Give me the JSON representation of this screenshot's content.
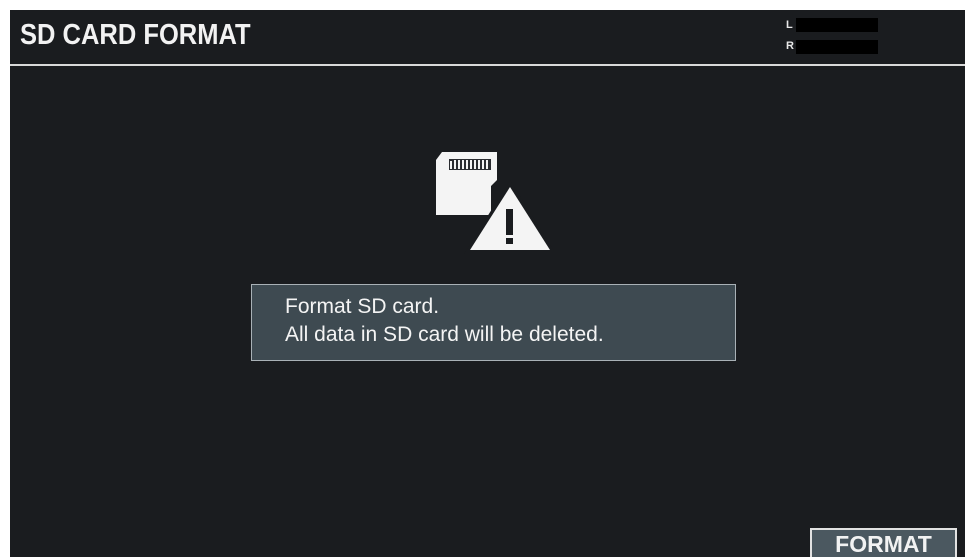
{
  "header": {
    "title": "SD CARD FORMAT",
    "meter": {
      "left_label": "L",
      "right_label": "R"
    }
  },
  "main": {
    "icons": [
      "sd-card-icon",
      "warning-icon"
    ],
    "warning_symbol": "!",
    "message": {
      "line1": "Format SD card.",
      "line2": "All data in SD card will be deleted."
    }
  },
  "function_buttons": {
    "format_label": "FORMAT"
  },
  "colors": {
    "background": "#1a1c1f",
    "message_box": "#3e4a51",
    "button": "#4b5860",
    "text": "#f2f2f2"
  }
}
